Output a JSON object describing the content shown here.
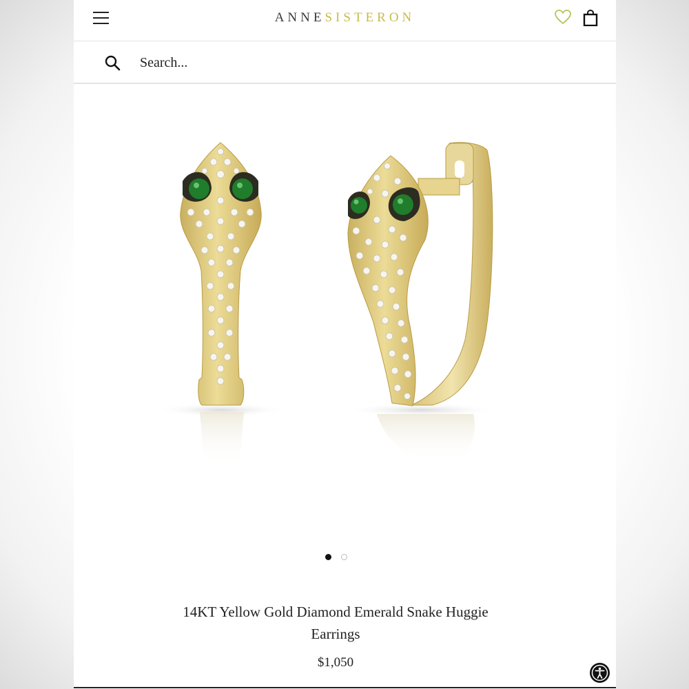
{
  "header": {
    "logo_part1": "ANNE",
    "logo_part2": "SISTERON",
    "menu_icon": "hamburger-icon",
    "wishlist_icon": "heart-icon",
    "cart_icon": "shopping-bag-icon"
  },
  "search": {
    "placeholder": "Search...",
    "icon": "search-icon"
  },
  "gallery": {
    "slide_count": 2,
    "active_slide": 1
  },
  "product": {
    "title": "14KT Yellow Gold Diamond Emerald Snake Huggie Earrings",
    "price": "$1,050"
  },
  "accessibility": {
    "icon": "accessibility-icon"
  },
  "colors": {
    "logo_dark": "#3a3a3a",
    "logo_gold": "#c8bb4a",
    "heart_green": "#b5c45a",
    "gold": "#dcc77c",
    "emerald": "#1f7d2c"
  }
}
